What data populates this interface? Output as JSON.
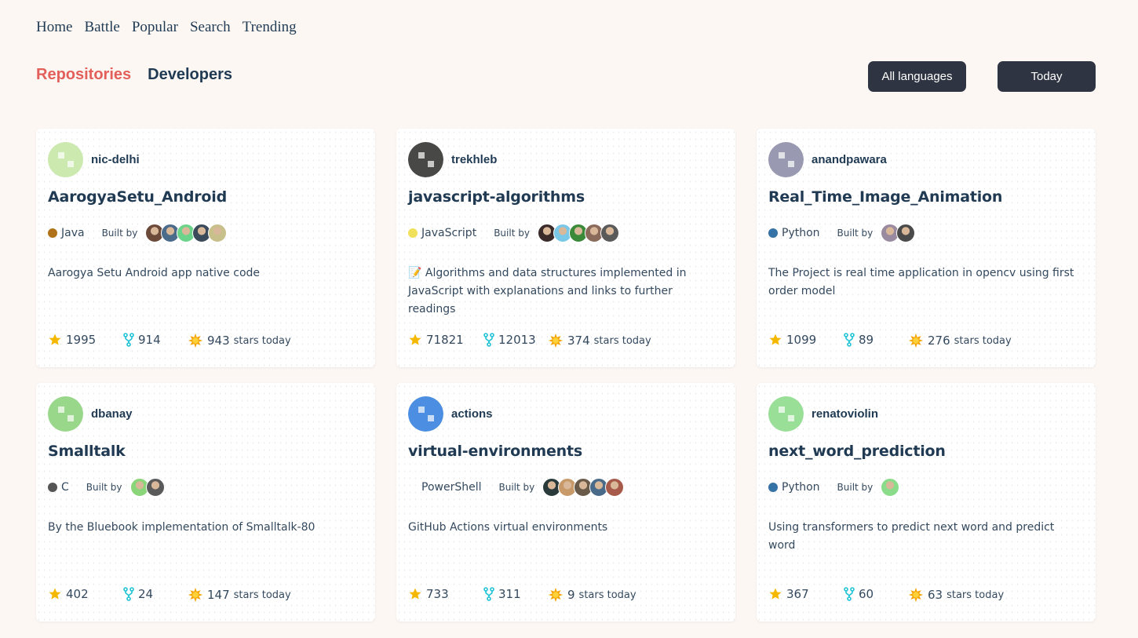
{
  "nav": [
    "Home",
    "Battle",
    "Popular",
    "Search",
    "Trending"
  ],
  "tabs": {
    "repositories": "Repositories",
    "developers": "Developers"
  },
  "filters": {
    "language": "All languages",
    "period": "Today"
  },
  "colors": {
    "accent": "#e35f5a",
    "dark": "#2e3441",
    "text": "#1f3a52",
    "star": "#f5b800",
    "fork": "#1ec3d6"
  },
  "built_by_label": "Built by",
  "stars_today_label": "stars today",
  "repos": [
    {
      "owner": "nic-delhi",
      "name": "AarogyaSetu_Android",
      "language": "Java",
      "lang_color": "#b07219",
      "description": "Aarogya Setu Android app native code",
      "stars": "1995",
      "forks": "914",
      "today": "943",
      "avatar_color": "#c6e8a4",
      "contributors": [
        "#6b4a3a",
        "#4a6b8a",
        "#6bd48a",
        "#3a4a5a",
        "#c8c08a"
      ]
    },
    {
      "owner": "trekhleb",
      "name": "javascript-algorithms",
      "language": "JavaScript",
      "lang_color": "#f1e05a",
      "description": "📝 Algorithms and data structures implemented in JavaScript with explanations and links to further readings",
      "stars": "71821",
      "forks": "12013",
      "today": "374",
      "avatar_color": "#2a2a2a",
      "contributors": [
        "#3a2a2a",
        "#7ac8e8",
        "#3a8a3a",
        "#8a6a5a",
        "#5a5a5a"
      ]
    },
    {
      "owner": "anandpawara",
      "name": "Real_Time_Image_Animation",
      "language": "Python",
      "lang_color": "#3572a5",
      "description": "The Project is real time application in opencv using first order model",
      "stars": "1099",
      "forks": "89",
      "today": "276",
      "avatar_color": "#8a8aa8",
      "contributors": [
        "#9a8aa0",
        "#4a4a4a"
      ]
    },
    {
      "owner": "dbanay",
      "name": "Smalltalk",
      "language": "C",
      "lang_color": "#555555",
      "description": "By the Bluebook implementation of Smalltalk-80",
      "stars": "402",
      "forks": "24",
      "today": "147",
      "avatar_color": "#8ad47a",
      "contributors": [
        "#8ad47a",
        "#5a5a5a"
      ]
    },
    {
      "owner": "actions",
      "name": "virtual-environments",
      "language": "PowerShell",
      "lang_color": "",
      "description": "GitHub Actions virtual environments",
      "stars": "733",
      "forks": "311",
      "today": "9",
      "avatar_color": "#2f7ee0",
      "contributors": [
        "#2a3a3a",
        "#c89a6a",
        "#6a5a4a",
        "#4a6a8a",
        "#a85a4a"
      ]
    },
    {
      "owner": "renatoviolin",
      "name": "next_word_prediction",
      "language": "Python",
      "lang_color": "#3572a5",
      "description": "Using transformers to predict next word and predict word",
      "stars": "367",
      "forks": "60",
      "today": "63",
      "avatar_color": "#8adc8a",
      "contributors": [
        "#8adc8a"
      ]
    }
  ]
}
